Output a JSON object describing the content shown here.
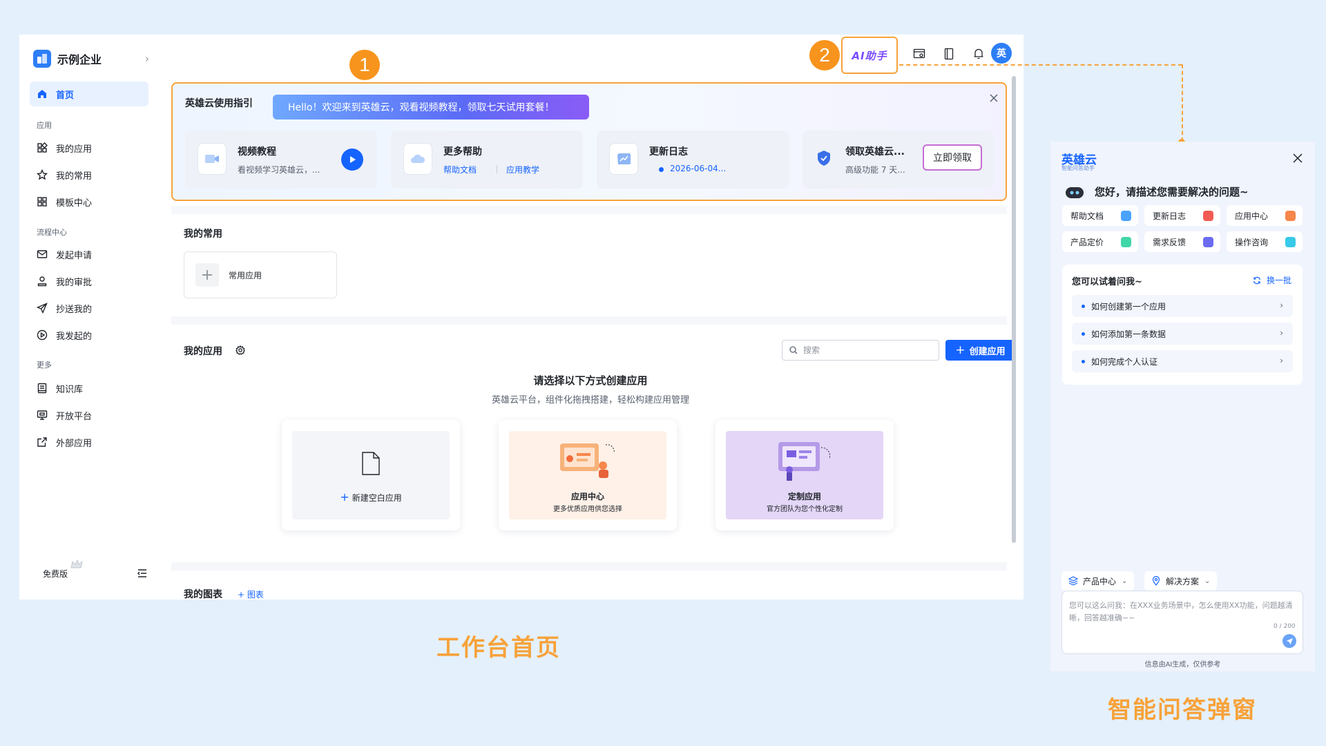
{
  "sidebar": {
    "org_name": "示例企业",
    "items": [
      {
        "label": "首页",
        "icon": "home-icon",
        "active": true
      },
      {
        "label": "我的应用",
        "icon": "apps-grid-icon"
      },
      {
        "label": "我的常用",
        "icon": "star-icon"
      },
      {
        "label": "模板中心",
        "icon": "template-grid-icon"
      },
      {
        "label": "发起申请",
        "icon": "mail-send-icon"
      },
      {
        "label": "我的审批",
        "icon": "user-stamp-icon"
      },
      {
        "label": "抄送我的",
        "icon": "paper-plane-icon"
      },
      {
        "label": "我发起的",
        "icon": "play-circle-icon"
      },
      {
        "label": "知识库",
        "icon": "book-icon"
      },
      {
        "label": "开放平台",
        "icon": "monitor-icon"
      },
      {
        "label": "外部应用",
        "icon": "external-link-icon"
      }
    ],
    "groups": [
      "应用",
      "流程中心",
      "更多"
    ],
    "plan_label": "免费版"
  },
  "topbar": {
    "ai_label": "AI助手",
    "avatar_text": "英",
    "callout_1": "1",
    "callout_2": "2"
  },
  "guide": {
    "title": "英雄云使用指引",
    "banner": "Hello！欢迎来到英雄云，观看视频教程，领取七天试用套餐！",
    "cards": [
      {
        "title": "视频教程",
        "sub": "看视频学习英雄云，..."
      },
      {
        "title": "更多帮助",
        "link1": "帮助文档",
        "link2": "应用教学"
      },
      {
        "title": "更新日志",
        "sub": "2026-06-04..."
      },
      {
        "title": "领取英雄云...",
        "sub": "高级功能 7 天...",
        "button": "立即领取"
      }
    ]
  },
  "favorites": {
    "title": "我的常用",
    "card_label": "常用应用"
  },
  "my_apps": {
    "title": "我的应用",
    "search_placeholder": "搜索",
    "create_button": "创建应用",
    "create_title": "请选择以下方式创建应用",
    "create_sub": "英雄云平台，组件化拖拽搭建，轻松构建应用管理",
    "options": [
      {
        "title": "新建空白应用"
      },
      {
        "title": "应用中心",
        "sub": "更多优质应用供您选择"
      },
      {
        "title": "定制应用",
        "sub": "官方团队为您个性化定制"
      }
    ]
  },
  "next_section": {
    "title": "我的图表",
    "link": "+ 图表"
  },
  "captions": {
    "workbench": "工作台首页",
    "ai_popup": "智能问答弹窗"
  },
  "ai": {
    "brand": "英雄云",
    "brand_sub": "智能问答助手",
    "greeting": "您好，请描述您需要解决的问题~",
    "quick": [
      {
        "label": "帮助文档",
        "color": "#4aa3ff"
      },
      {
        "label": "更新日志",
        "color": "#f25c54"
      },
      {
        "label": "应用中心",
        "color": "#f7874a"
      },
      {
        "label": "产品定价",
        "color": "#3fd6a8"
      },
      {
        "label": "需求反馈",
        "color": "#6b6bf2"
      },
      {
        "label": "操作咨询",
        "color": "#38c9e8"
      }
    ],
    "try_title": "您可以试着问我~",
    "refresh": "换一批",
    "suggestions": [
      "如何创建第一个应用",
      "如何添加第一条数据",
      "如何完成个人认证"
    ],
    "chip_1": "产品中心",
    "chip_2": "解决方案",
    "input_placeholder": "您可以这么问我：在XXX业务场景中，怎么使用XX功能，问题越清晰，回答越准确~~",
    "counter": "0 / 200",
    "footer": "信息由AI生成，仅供参考"
  }
}
